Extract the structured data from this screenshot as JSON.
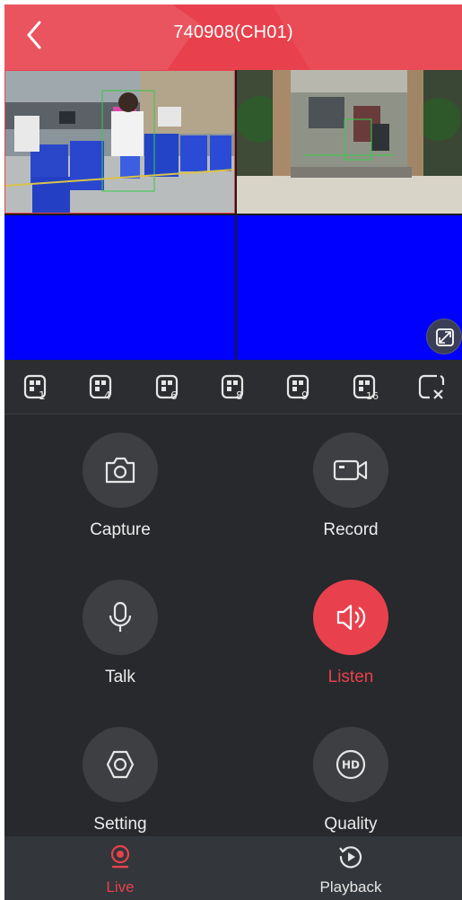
{
  "header": {
    "title": "740908(CH01)",
    "back_icon": "chevron-left-icon"
  },
  "video_grid": {
    "cells": [
      {
        "content": "camera-feed-indoor-warehouse",
        "selected": true
      },
      {
        "content": "camera-feed-entrance",
        "selected": false
      },
      {
        "content": "no-signal-blue",
        "selected": false
      },
      {
        "content": "no-signal-blue",
        "selected": false
      }
    ],
    "expand_icon": "fullscreen-icon"
  },
  "split_bar": {
    "items": [
      {
        "icon": "split-1-icon",
        "label": "1"
      },
      {
        "icon": "split-4-icon",
        "label": "4"
      },
      {
        "icon": "split-6-icon",
        "label": "6"
      },
      {
        "icon": "split-8-icon",
        "label": "8"
      },
      {
        "icon": "split-9-icon",
        "label": "9"
      },
      {
        "icon": "split-16-icon",
        "label": "16"
      },
      {
        "icon": "close-window-icon",
        "label": ""
      }
    ]
  },
  "controls": {
    "capture": {
      "label": "Capture",
      "icon": "camera-icon"
    },
    "record": {
      "label": "Record",
      "icon": "video-camera-icon"
    },
    "talk": {
      "label": "Talk",
      "icon": "microphone-icon"
    },
    "listen": {
      "label": "Listen",
      "icon": "speaker-icon",
      "active": true
    },
    "setting": {
      "label": "Setting",
      "icon": "settings-icon"
    },
    "quality": {
      "label": "Quality",
      "icon": "hd-icon",
      "badge": "HD"
    }
  },
  "bottom_nav": {
    "items": [
      {
        "label": "Live",
        "icon": "webcam-icon",
        "active": true
      },
      {
        "label": "Playback",
        "icon": "playback-icon",
        "active": false
      }
    ]
  },
  "colors": {
    "accent": "#e8414d",
    "no_signal": "#0000fe",
    "panel_bg": "#27292c"
  }
}
